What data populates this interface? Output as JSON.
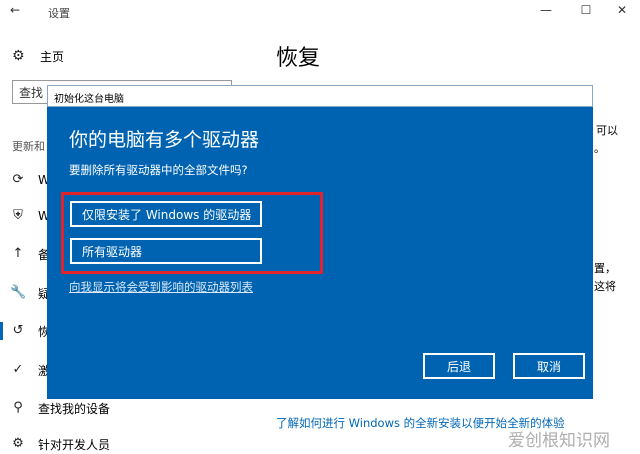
{
  "window": {
    "back_glyph": "←",
    "title": "设置",
    "minimize_glyph": "—",
    "maximize_glyph": "☐",
    "close_glyph": "✕"
  },
  "sidebar": {
    "home_label": "主页",
    "search_value": "查找",
    "section_label": "更新和",
    "items": [
      {
        "icon": "refresh-icon",
        "glyph": "⟳",
        "label": "W"
      },
      {
        "icon": "shield-icon",
        "glyph": "⛨",
        "label": "W"
      },
      {
        "icon": "upload-arrow-icon",
        "glyph": "↑",
        "label": "备"
      },
      {
        "icon": "wrench-icon",
        "glyph": "🔧",
        "label": "疑"
      },
      {
        "icon": "history-icon",
        "glyph": "↺",
        "label": "恢"
      },
      {
        "icon": "check-circle-icon",
        "glyph": "✓",
        "label": "激"
      },
      {
        "icon": "person-location-icon",
        "glyph": "⚲",
        "label": "查找我的设备"
      },
      {
        "icon": "developer-icon",
        "glyph": "⚙",
        "label": "针对开发人员"
      }
    ]
  },
  "main": {
    "title": "恢复",
    "fragments": [
      "可以",
      "。",
      "置，",
      "这将"
    ],
    "bottom_link": "了解如何进行 Windows 的全新安装以便开始全新的体验"
  },
  "dialog": {
    "title": "初始化这台电脑",
    "heading": "你的电脑有多个驱动器",
    "question": "要删除所有驱动器中的全部文件吗?",
    "option_1": "仅限安装了 Windows 的驱动器",
    "option_2": "所有驱动器",
    "link": "向我显示将会受到影响的驱动器列表",
    "back_button": "后退",
    "cancel_button": "取消"
  },
  "watermark": "爱创根知识网",
  "colors": {
    "dialog_blue": "#0063b1",
    "link_blue": "#0067b8",
    "highlight_red": "#e0242e"
  }
}
